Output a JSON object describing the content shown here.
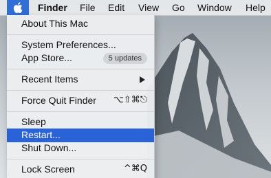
{
  "menubar": {
    "apple_icon": "apple-logo-icon",
    "items": [
      "Finder",
      "File",
      "Edit",
      "View",
      "Go",
      "Window",
      "Help"
    ]
  },
  "apple_menu": {
    "about": "About This Mac",
    "system_preferences": "System Preferences...",
    "app_store": "App Store...",
    "app_store_badge": "5 updates",
    "recent_items": "Recent Items",
    "force_quit": "Force Quit Finder",
    "force_quit_shortcut": "⌥⇧⌘⎋",
    "sleep": "Sleep",
    "restart": "Restart...",
    "shut_down": "Shut Down...",
    "lock_screen": "Lock Screen",
    "lock_screen_shortcut": "^⌘Q"
  },
  "colors": {
    "highlight": "#2a63d8",
    "menu_background": "#eceef0"
  }
}
